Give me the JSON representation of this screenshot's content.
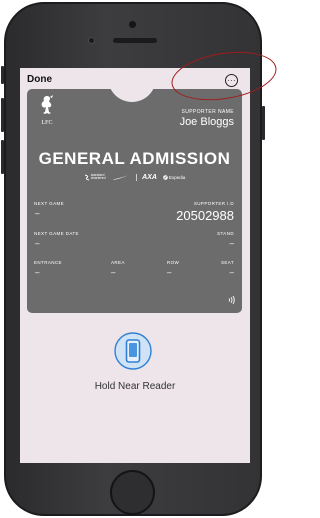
{
  "header": {
    "done_label": "Done",
    "more_icon": "ellipsis-circle-icon"
  },
  "pass": {
    "club_abbr": "LFC",
    "supporter_name_label": "SUPPORTER NAME",
    "supporter_name": "Joe Bloggs",
    "ticket_type": "GENERAL ADMISSION",
    "sponsors": {
      "standard_chartered_line1": "standard",
      "standard_chartered_line2": "chartered",
      "axa": "AXA",
      "expedia": "Expedia"
    },
    "next_game_label": "NEXT GAME",
    "next_game": "–",
    "supporter_id_label": "SUPPORTER I.D",
    "supporter_id": "20502988",
    "next_game_date_label": "NEXT GAME DATE",
    "next_game_date": "–",
    "stand_label": "STAND",
    "stand": "–",
    "entrance_label": "ENTRANCE",
    "entrance": "–",
    "area_label": "AREA",
    "area": "–",
    "row_label": "ROW",
    "row": "–",
    "seat_label": "SEAT",
    "seat": "–",
    "nfc_icon": "contactless-icon"
  },
  "reader": {
    "text": "Hold Near Reader",
    "icon": "phone-reader-icon"
  },
  "colors": {
    "pass_background": "#6c6c6c",
    "screen_background": "#ede5ea",
    "reader_accent": "#2f80d4",
    "annotation": "#a01c1c"
  }
}
